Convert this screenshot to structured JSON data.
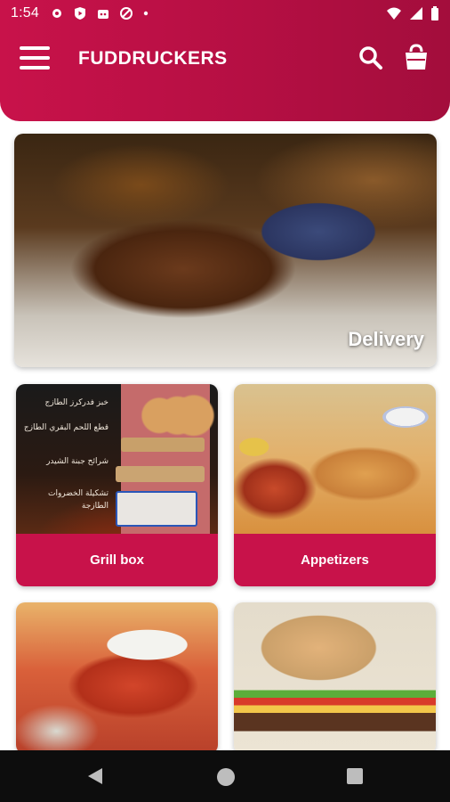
{
  "status_bar": {
    "time": "1:54",
    "left_icons": [
      "gear-icon",
      "play-protect-icon",
      "robot-icon",
      "blocked-icon",
      "dot-icon"
    ],
    "right_icons": [
      "wifi-icon",
      "signal-icon",
      "battery-icon"
    ]
  },
  "header": {
    "title": "FUDDRUCKERS",
    "menu_icon": "hamburger-menu-icon",
    "search_icon": "search-icon",
    "cart_icon": "shopping-bag-icon"
  },
  "hero": {
    "label": "Delivery"
  },
  "categories": [
    {
      "label": "Grill box"
    },
    {
      "label": "Appetizers"
    }
  ],
  "grill_box_ad_text": [
    "خبز فدركرز الطازج",
    "قطع اللحم البقري الطازج",
    "شرائح جبنة الشيدر",
    "تشكيلة الخضروات الطازجة"
  ],
  "nav_bar": {
    "icons": [
      "back-icon",
      "home-icon",
      "recents-icon"
    ]
  },
  "colors": {
    "brand": "#c8124a",
    "navbar": "#0d0d0d"
  }
}
